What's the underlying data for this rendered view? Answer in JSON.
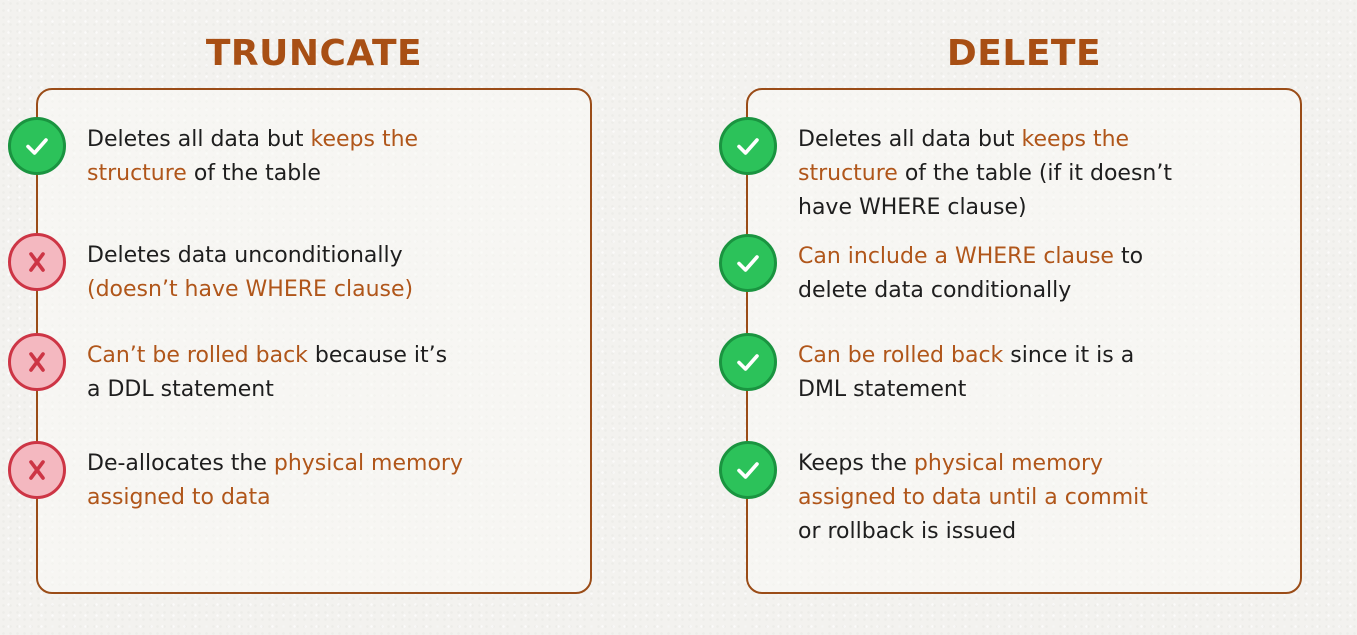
{
  "colors": {
    "accent": "#a84f14",
    "highlight": "#b0561a",
    "check": "#2cc25a",
    "cross": "#cd3545",
    "cross_fill": "#f4b8c0"
  },
  "truncate": {
    "title": "TRUNCATE",
    "items": [
      {
        "icon": "check-icon",
        "lines": [
          [
            {
              "t": "Deletes all data but ",
              "h": false
            },
            {
              "t": "keeps the",
              "h": true
            }
          ],
          [
            {
              "t": "structure",
              "h": true
            },
            {
              "t": " of the table",
              "h": false
            }
          ]
        ]
      },
      {
        "icon": "x-icon",
        "lines": [
          [
            {
              "t": "Deletes data unconditionally",
              "h": false
            }
          ],
          [
            {
              "t": "(doesn’t have WHERE clause)",
              "h": true
            }
          ]
        ]
      },
      {
        "icon": "x-icon",
        "lines": [
          [
            {
              "t": "Can’t be rolled back",
              "h": true
            },
            {
              "t": " because it’s",
              "h": false
            }
          ],
          [
            {
              "t": "a DDL statement",
              "h": false
            }
          ]
        ]
      },
      {
        "icon": "x-icon",
        "lines": [
          [
            {
              "t": "De-allocates the ",
              "h": false
            },
            {
              "t": "physical memory",
              "h": true
            }
          ],
          [
            {
              "t": "assigned to data",
              "h": true
            }
          ]
        ]
      }
    ]
  },
  "delete": {
    "title": "DELETE",
    "items": [
      {
        "icon": "check-icon",
        "lines": [
          [
            {
              "t": "Deletes all data but ",
              "h": false
            },
            {
              "t": "keeps the",
              "h": true
            }
          ],
          [
            {
              "t": "structure",
              "h": true
            },
            {
              "t": " of the table (if it doesn’t",
              "h": false
            }
          ],
          [
            {
              "t": "have WHERE clause)",
              "h": false
            }
          ]
        ]
      },
      {
        "icon": "check-icon",
        "lines": [
          [
            {
              "t": "Can include a WHERE clause",
              "h": true
            },
            {
              "t": " to",
              "h": false
            }
          ],
          [
            {
              "t": "delete data conditionally",
              "h": false
            }
          ]
        ]
      },
      {
        "icon": "check-icon",
        "lines": [
          [
            {
              "t": "Can be rolled back",
              "h": true
            },
            {
              "t": " since it is a",
              "h": false
            }
          ],
          [
            {
              "t": "DML statement",
              "h": false
            }
          ]
        ]
      },
      {
        "icon": "check-icon",
        "lines": [
          [
            {
              "t": "Keeps the ",
              "h": false
            },
            {
              "t": "physical memory",
              "h": true
            }
          ],
          [
            {
              "t": "assigned to data until a commit",
              "h": true
            }
          ],
          [
            {
              "t": "or rollback is issued",
              "h": false
            }
          ]
        ]
      }
    ]
  }
}
